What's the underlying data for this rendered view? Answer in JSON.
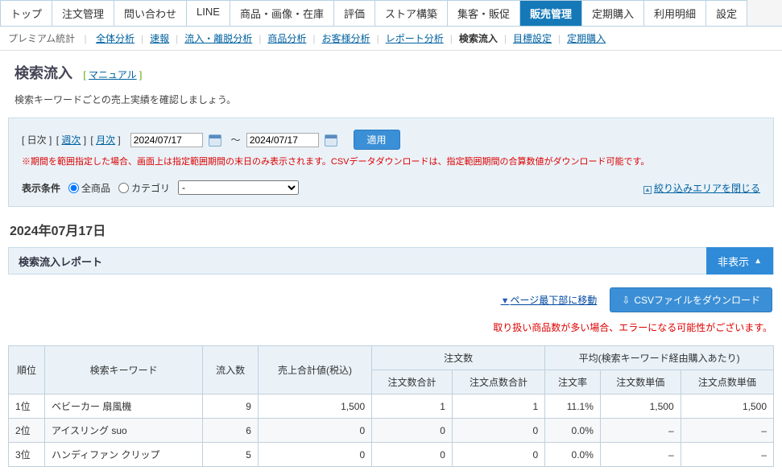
{
  "tabs": [
    "トップ",
    "注文管理",
    "問い合わせ",
    "LINE",
    "商品・画像・在庫",
    "評価",
    "ストア構築",
    "集客・販促",
    "販売管理",
    "定期購入",
    "利用明細",
    "設定"
  ],
  "tabs_active_index": 8,
  "subnav": {
    "premium": "プレミアム統計",
    "items": [
      "全体分析",
      "速報",
      "流入・離脱分析",
      "商品分析",
      "お客様分析",
      "レポート分析",
      "検索流入",
      "目標設定",
      "定期購入"
    ],
    "active_index": 6
  },
  "page": {
    "title": "検索流入",
    "manual_bracket_open": "[",
    "manual": "マニュアル",
    "manual_bracket_close": "]",
    "desc": "検索キーワードごとの売上実績を確認しましょう。"
  },
  "filter": {
    "day": "[ 日次 ]",
    "week": "週次",
    "month": "月次",
    "date_from": "2024/07/17",
    "date_to": "2024/07/17",
    "apply": "適用",
    "note": "※期間を範囲指定した場合、画面上は指定範囲期間の末日のみ表示されます。CSVデータダウンロードは、指定範囲期間の合算数値がダウンロード可能です。",
    "cond_label": "表示条件",
    "radio_all": "全商品",
    "radio_cat": "カテゴリ",
    "cat_placeholder": "-",
    "close": "絞り込みエリアを閉じる"
  },
  "date_heading": "2024年07月17日",
  "report": {
    "title": "検索流入レポート",
    "hide": "非表示",
    "scroll_bottom": "ページ最下部に移動",
    "csv": "CSVファイルをダウンロード",
    "warn": "取り扱い商品数が多い場合、エラーになる可能性がございます。"
  },
  "table": {
    "h_rank": "順位",
    "h_keyword": "検索キーワード",
    "h_inflow": "流入数",
    "h_sales": "売上合計値(税込)",
    "h_orders_group": "注文数",
    "h_orders_total": "注文数合計",
    "h_items_total": "注文点数合計",
    "h_avg_group": "平均(検索キーワード経由購入あたり)",
    "h_order_rate": "注文率",
    "h_order_price": "注文数単価",
    "h_item_price": "注文点数単価",
    "rows": [
      {
        "rank": "1位",
        "kw": "ベビーカー 扇風機",
        "inflow": "9",
        "sales": "1,500",
        "orders": "1",
        "items": "1",
        "rate": "11.1%",
        "oprice": "1,500",
        "iprice": "1,500"
      },
      {
        "rank": "2位",
        "kw": "アイスリング suo",
        "inflow": "6",
        "sales": "0",
        "orders": "0",
        "items": "0",
        "rate": "0.0%",
        "oprice": "–",
        "iprice": "–"
      },
      {
        "rank": "3位",
        "kw": "ハンディファン クリップ",
        "inflow": "5",
        "sales": "0",
        "orders": "0",
        "items": "0",
        "rate": "0.0%",
        "oprice": "–",
        "iprice": "–"
      }
    ]
  }
}
